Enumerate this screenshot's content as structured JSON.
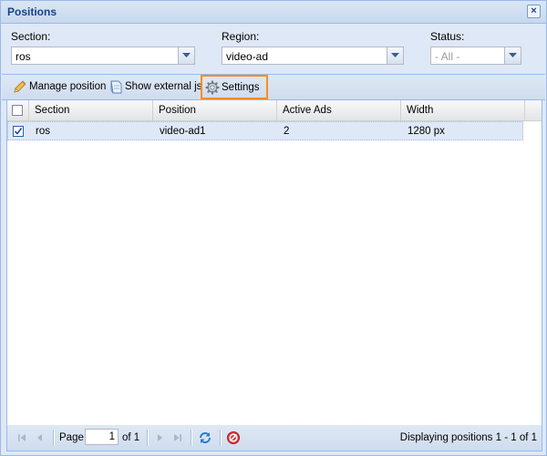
{
  "window": {
    "title": "Positions",
    "close_label": "×"
  },
  "filters": {
    "section": {
      "label": "Section:",
      "value": "ros"
    },
    "region": {
      "label": "Region:",
      "value": "video-ad"
    },
    "status": {
      "label": "Status:",
      "value": "- All -"
    }
  },
  "toolbar": {
    "manage_label": "Manage position",
    "external_label": "Show external js",
    "settings_label": "Settings",
    "highlight_color": "#ff8c1a"
  },
  "grid": {
    "columns": [
      "Section",
      "Position",
      "Active Ads",
      "Width"
    ],
    "rows": [
      {
        "checked": true,
        "cells": [
          "ros",
          "video-ad1",
          "2",
          "1280 px"
        ]
      }
    ]
  },
  "pager": {
    "page_label": "Page",
    "page_value": "1",
    "of_label": "of 1",
    "info": "Displaying positions 1 - 1 of 1"
  }
}
